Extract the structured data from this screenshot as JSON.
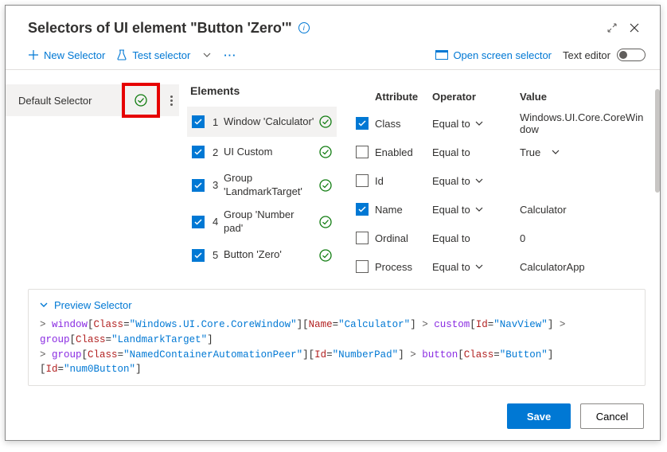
{
  "title": "Selectors of UI element \"Button 'Zero'\"",
  "toolbar": {
    "new_selector": "New Selector",
    "test_selector": "Test selector",
    "open_screen": "Open screen selector",
    "text_editor": "Text editor"
  },
  "left": {
    "default_selector": "Default Selector"
  },
  "elements": {
    "heading": "Elements",
    "items": [
      {
        "idx": "1",
        "label": "Window 'Calculator'"
      },
      {
        "idx": "2",
        "label": "UI Custom"
      },
      {
        "idx": "3",
        "label": "Group 'LandmarkTarget'"
      },
      {
        "idx": "4",
        "label": "Group 'Number pad'"
      },
      {
        "idx": "5",
        "label": "Button 'Zero'"
      }
    ]
  },
  "attrs": {
    "h_attr": "Attribute",
    "h_op": "Operator",
    "h_val": "Value",
    "op_eq": "Equal to",
    "rows": [
      {
        "checked": true,
        "name": "Class",
        "chev": true,
        "value": "Windows.UI.Core.CoreWindow",
        "valchev": false
      },
      {
        "checked": false,
        "name": "Enabled",
        "chev": false,
        "value": "True",
        "valchev": true
      },
      {
        "checked": false,
        "name": "Id",
        "chev": true,
        "value": "",
        "valchev": false
      },
      {
        "checked": true,
        "name": "Name",
        "chev": true,
        "value": "Calculator",
        "valchev": false
      },
      {
        "checked": false,
        "name": "Ordinal",
        "chev": false,
        "value": "0",
        "valchev": false
      },
      {
        "checked": false,
        "name": "Process",
        "chev": true,
        "value": "CalculatorApp",
        "valchev": false
      }
    ]
  },
  "preview": {
    "heading": "Preview Selector",
    "tokens": {
      "window": "window",
      "custom": "custom",
      "group": "group",
      "button": "button",
      "Class": "Class",
      "Name": "Name",
      "Id": "Id",
      "v_core": "\"Windows.UI.Core.CoreWindow\"",
      "v_calc": "\"Calculator\"",
      "v_nav": "\"NavView\"",
      "v_lm": "\"LandmarkTarget\"",
      "v_ncap": "\"NamedContainerAutomationPeer\"",
      "v_np": "\"NumberPad\"",
      "v_btn": "\"Button\"",
      "v_num0": "\"num0Button\""
    }
  },
  "footer": {
    "save": "Save",
    "cancel": "Cancel"
  }
}
